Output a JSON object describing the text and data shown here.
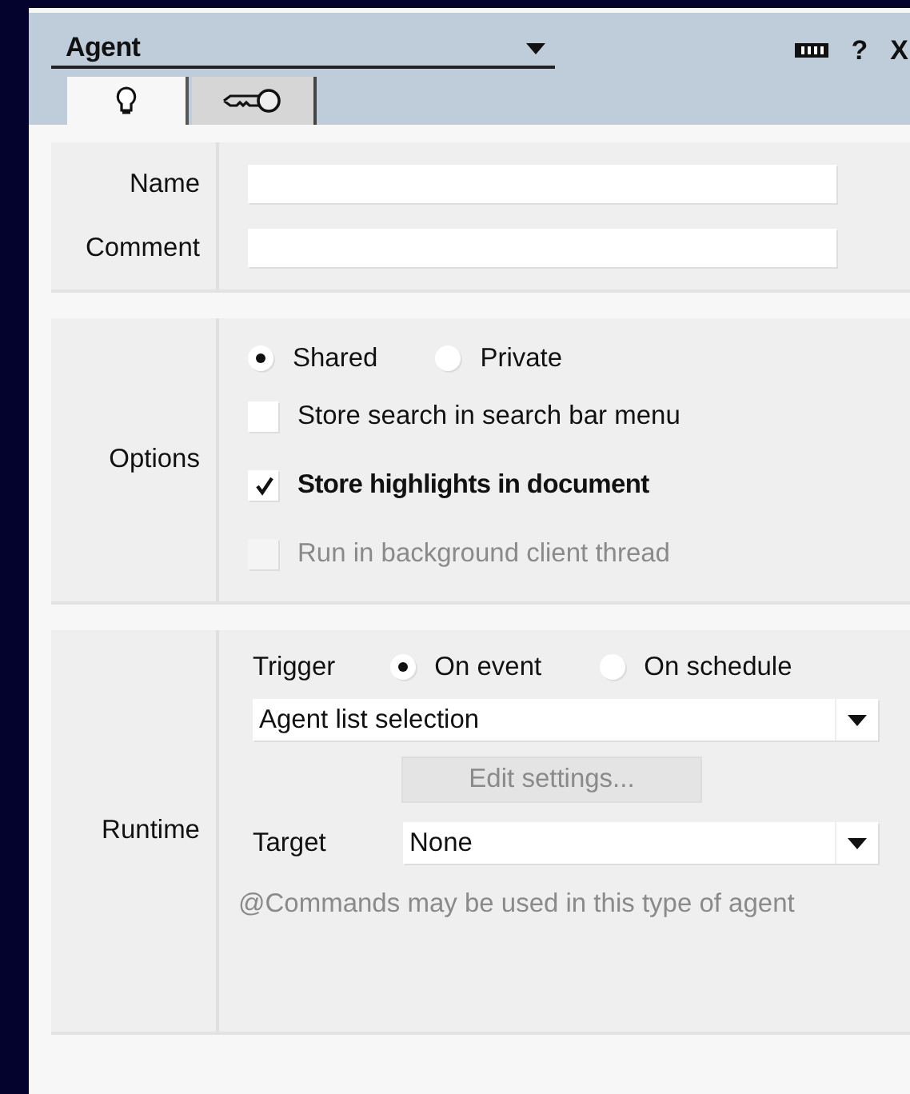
{
  "panel": {
    "title": "Agent",
    "help": "?",
    "close": "X"
  },
  "tabs": [
    {
      "kind": "bulb",
      "selected": true
    },
    {
      "kind": "key",
      "selected": false
    }
  ],
  "identity": {
    "fields": [
      {
        "label": "Name"
      },
      {
        "label": "Comment"
      }
    ]
  },
  "options": {
    "label": "Options",
    "sharing": [
      {
        "label": "Shared",
        "selected": true
      },
      {
        "label": "Private",
        "selected": false
      }
    ],
    "checks": [
      {
        "label": "Store search in search bar menu",
        "checked": false,
        "disabled": false
      },
      {
        "label": "Store highlights in document",
        "checked": true,
        "disabled": false
      },
      {
        "label": "Run in background client thread",
        "checked": false,
        "disabled": true
      }
    ]
  },
  "runtime": {
    "label": "Runtime",
    "trigger_label": "Trigger",
    "triggers": [
      {
        "label": "On event",
        "selected": true
      },
      {
        "label": "On schedule",
        "selected": false
      }
    ],
    "event": {
      "value": "Agent list selection"
    },
    "edit_button": {
      "label": "Edit settings...",
      "disabled": true
    },
    "target_label": "Target",
    "target": {
      "value": "None"
    },
    "note": "@Commands may be used in this type of agent"
  }
}
